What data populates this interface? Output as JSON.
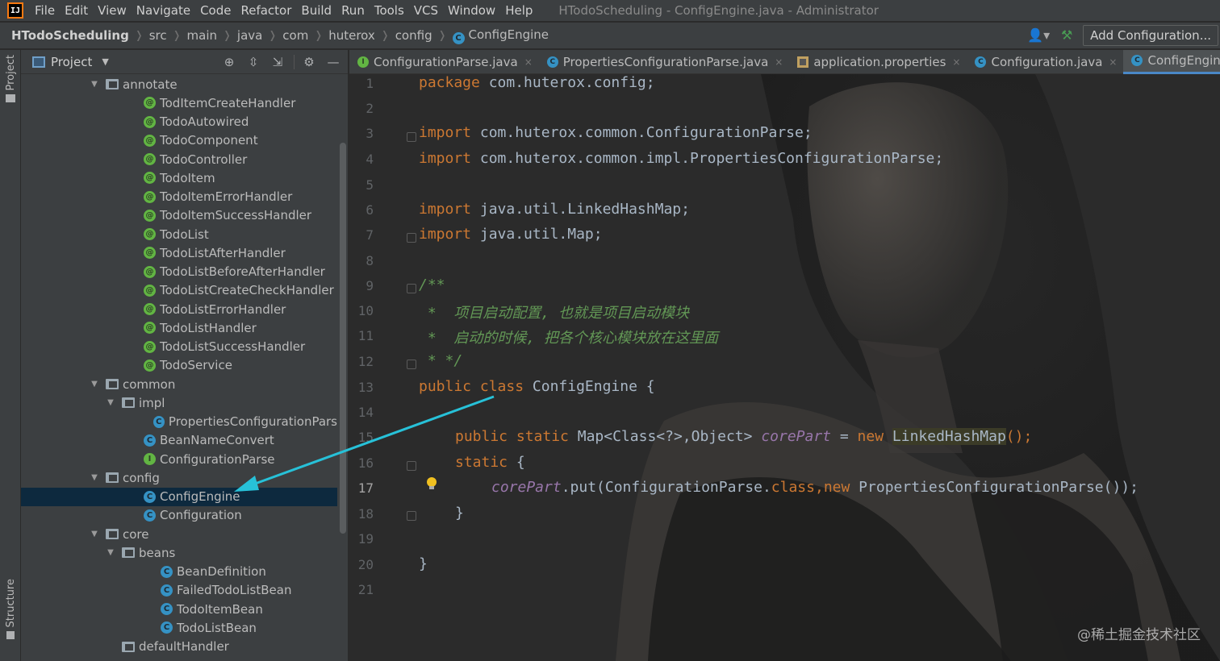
{
  "menubar": {
    "logo": "IJ",
    "items": [
      "File",
      "Edit",
      "View",
      "Navigate",
      "Code",
      "Refactor",
      "Build",
      "Run",
      "Tools",
      "VCS",
      "Window",
      "Help"
    ],
    "window_title": "HTodoScheduling - ConfigEngine.java - Administrator"
  },
  "navbar": {
    "breadcrumbs": [
      "HTodoScheduling",
      "src",
      "main",
      "java",
      "com",
      "huterox",
      "config",
      "ConfigEngine"
    ],
    "add_configuration": "Add Configuration..."
  },
  "left_stripe": {
    "project_label": "Project",
    "structure_label": "Structure"
  },
  "project_panel": {
    "title": "Project",
    "tree": [
      {
        "label": "annotate",
        "type": "folder",
        "depth": 1,
        "expanded": true
      },
      {
        "label": "TodItemCreateHandler",
        "type": "annotation",
        "depth": 2
      },
      {
        "label": "TodoAutowired",
        "type": "annotation",
        "depth": 2
      },
      {
        "label": "TodoComponent",
        "type": "annotation",
        "depth": 2
      },
      {
        "label": "TodoController",
        "type": "annotation",
        "depth": 2
      },
      {
        "label": "TodoItem",
        "type": "annotation",
        "depth": 2
      },
      {
        "label": "TodoItemErrorHandler",
        "type": "annotation",
        "depth": 2
      },
      {
        "label": "TodoItemSuccessHandler",
        "type": "annotation",
        "depth": 2
      },
      {
        "label": "TodoList",
        "type": "annotation",
        "depth": 2
      },
      {
        "label": "TodoListAfterHandler",
        "type": "annotation",
        "depth": 2
      },
      {
        "label": "TodoListBeforeAfterHandler",
        "type": "annotation",
        "depth": 2
      },
      {
        "label": "TodoListCreateCheckHandler",
        "type": "annotation",
        "depth": 2
      },
      {
        "label": "TodoListErrorHandler",
        "type": "annotation",
        "depth": 2
      },
      {
        "label": "TodoListHandler",
        "type": "annotation",
        "depth": 2
      },
      {
        "label": "TodoListSuccessHandler",
        "type": "annotation",
        "depth": 2
      },
      {
        "label": "TodoService",
        "type": "annotation",
        "depth": 2
      },
      {
        "label": "common",
        "type": "folder",
        "depth": 1,
        "expanded": true
      },
      {
        "label": "impl",
        "type": "folder",
        "depth": 2,
        "expanded": true
      },
      {
        "label": "PropertiesConfigurationPars",
        "type": "class",
        "depth": 3
      },
      {
        "label": "BeanNameConvert",
        "type": "class",
        "depth": 2
      },
      {
        "label": "ConfigurationParse",
        "type": "interface",
        "depth": 2
      },
      {
        "label": "config",
        "type": "folder",
        "depth": 1,
        "expanded": true
      },
      {
        "label": "ConfigEngine",
        "type": "class",
        "depth": 2,
        "selected": true
      },
      {
        "label": "Configuration",
        "type": "class",
        "depth": 2
      },
      {
        "label": "core",
        "type": "folder",
        "depth": 1,
        "expanded": true
      },
      {
        "label": "beans",
        "type": "folder",
        "depth": 2,
        "expanded": true
      },
      {
        "label": "BeanDefinition",
        "type": "class",
        "depth": 3
      },
      {
        "label": "FailedTodoListBean",
        "type": "class",
        "depth": 3
      },
      {
        "label": "TodoItemBean",
        "type": "class",
        "depth": 3
      },
      {
        "label": "TodoListBean",
        "type": "class",
        "depth": 3
      },
      {
        "label": "defaultHandler",
        "type": "folder",
        "depth": 2,
        "expanded": false
      }
    ]
  },
  "editor_tabs": [
    {
      "label": "ConfigurationParse.java",
      "icon": "interface",
      "active": false
    },
    {
      "label": "PropertiesConfigurationParse.java",
      "icon": "class",
      "active": false
    },
    {
      "label": "application.properties",
      "icon": "properties",
      "active": false
    },
    {
      "label": "Configuration.java",
      "icon": "class",
      "active": false
    },
    {
      "label": "ConfigEngine.java",
      "icon": "class",
      "active": true
    }
  ],
  "editor": {
    "line_numbers": [
      "1",
      "2",
      "3",
      "4",
      "5",
      "6",
      "7",
      "8",
      "9",
      "10",
      "11",
      "12",
      "13",
      "14",
      "15",
      "16",
      "17",
      "18",
      "19",
      "20",
      "21"
    ],
    "lines": {
      "l1_kw": "package",
      "l1_rest": " com.huterox.config;",
      "l3_kw": "import",
      "l3_rest": " com.huterox.common.ConfigurationParse;",
      "l4_kw": "import",
      "l4_rest": " com.huterox.common.impl.PropertiesConfigurationParse;",
      "l6_kw": "import",
      "l6_rest": " java.util.LinkedHashMap;",
      "l7_kw": "import",
      "l7_rest": " java.util.Map;",
      "l9": "/**",
      "l10": " *  项目启动配置, 也就是项目启动模块",
      "l11": " *  启动的时候, 把各个核心模块放在这里面",
      "l12": " * */",
      "l13_kw1": "public",
      "l13_kw2": "class",
      "l13_rest": " ConfigEngine {",
      "l15_kw1": "public",
      "l15_kw2": "static",
      "l15_type": " Map<Class<?>,Object> ",
      "l15_field": "corePart",
      "l15_eq": " = ",
      "l15_new": "new",
      "l15_hl": "LinkedHashMap",
      "l15_end": "();",
      "l16_kw": "static",
      "l16_rest": " {",
      "l17_field": "corePart",
      "l17_mid": ".put(ConfigurationParse.",
      "l17_cls": "class",
      "l17_comma": ",",
      "l17_new": "new",
      "l17_end": " PropertiesConfigurationParse());",
      "l18": "}",
      "l20": "}"
    }
  },
  "watermark": "@稀土掘金技术社区",
  "colors": {
    "keyword": "#cc7832",
    "comment": "#629755",
    "field": "#9876aa",
    "arrow": "#27c1d8",
    "selection": "#0d293e"
  }
}
